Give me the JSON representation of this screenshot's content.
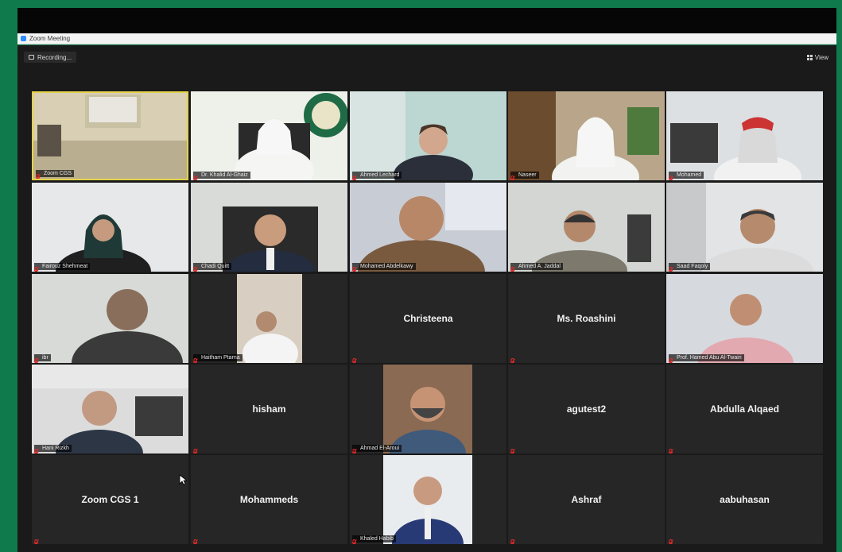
{
  "window": {
    "title": "Zoom Meeting"
  },
  "toolbar": {
    "recording_label": "Recording...",
    "view_label": "View"
  },
  "colors": {
    "frame_green": "#0f7a4c",
    "active_speaker": "#e4d24a",
    "muted_red": "#e02828"
  },
  "participants": [
    {
      "name": "Zoom CGS",
      "video": true
    },
    {
      "name": "Dr. Khalid Al-Ghaiz",
      "video": true
    },
    {
      "name": "Ahmed Lechard",
      "video": true
    },
    {
      "name": "Naseer",
      "video": true
    },
    {
      "name": "Mohamed",
      "video": true
    },
    {
      "name": "Fairouz Shehmeat",
      "video": true
    },
    {
      "name": "Chadi Quitt",
      "video": true
    },
    {
      "name": "Mohamed Abdelkawy",
      "video": true
    },
    {
      "name": "Ahmed A. Jaddal",
      "video": true
    },
    {
      "name": "Saad Faqoly",
      "video": true
    },
    {
      "name": "ibr",
      "video": true
    },
    {
      "name": "Haitham Ptarna",
      "video": true
    },
    {
      "name": "Christeena",
      "video": false
    },
    {
      "name": "Ms. Roashini",
      "video": false
    },
    {
      "name": "Prof. Hamed Abu Al-Twairi",
      "video": true
    },
    {
      "name": "Hani Rizkh",
      "video": true
    },
    {
      "name": "hisham",
      "video": false
    },
    {
      "name": "Ahmad El-Aroui",
      "video": true
    },
    {
      "name": "agutest2",
      "video": false
    },
    {
      "name": "Abdulla Alqaed",
      "video": false
    },
    {
      "name": "Zoom CGS 1",
      "video": false
    },
    {
      "name": "Mohammeds",
      "video": false
    },
    {
      "name": "Khaled Habib",
      "video": true
    },
    {
      "name": "Ashraf",
      "video": false
    },
    {
      "name": "aabuhasan",
      "video": false
    }
  ]
}
